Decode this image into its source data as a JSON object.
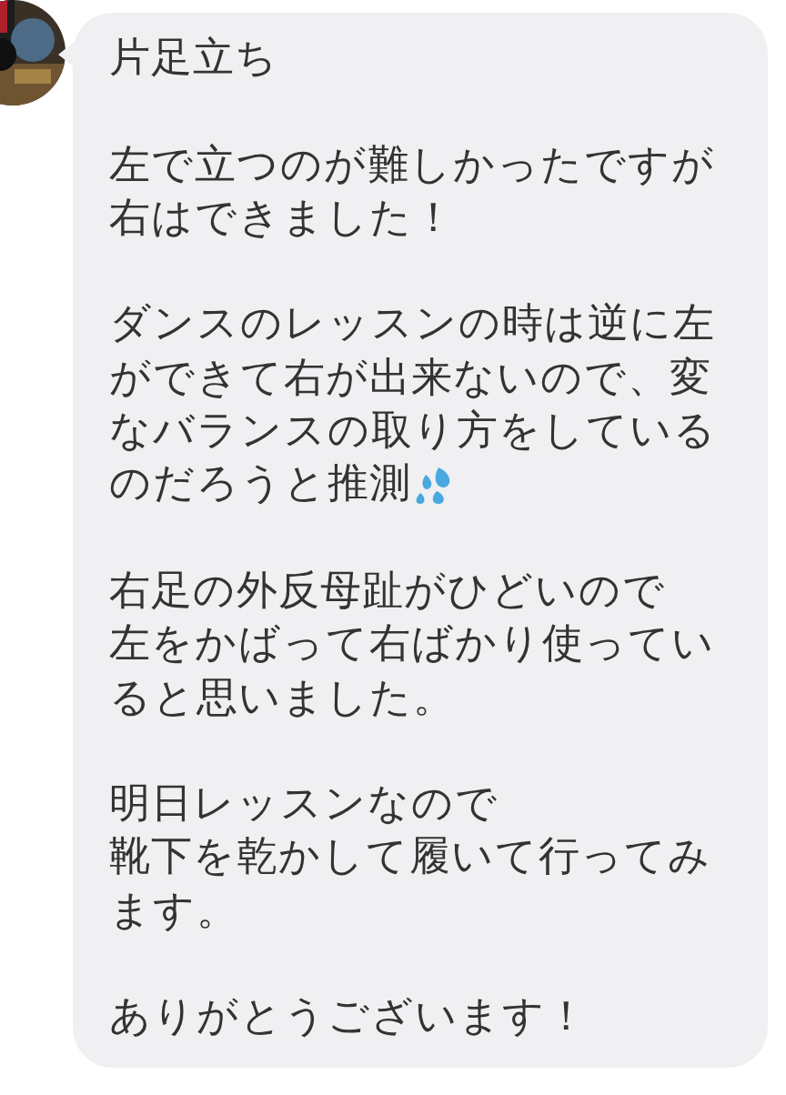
{
  "message": {
    "paragraphs": [
      {
        "lines": [
          {
            "text": "片足立ち"
          }
        ]
      },
      {
        "lines": [
          {
            "text": "左で立つのが難しかったですが右はできました！"
          }
        ]
      },
      {
        "lines": [
          {
            "text": "ダンスのレッスンの時は逆に左ができて右が出来ないので、変なバランスの取り方をしている"
          },
          {
            "text": "のだろうと推測",
            "trailing_emoji": true
          }
        ]
      },
      {
        "lines": [
          {
            "text": "右足の外反母趾がひどいので"
          },
          {
            "text": "左をかばって右ばかり使っていると思いました。"
          }
        ]
      },
      {
        "lines": [
          {
            "text": "明日レッスンなので"
          },
          {
            "text": "靴下を乾かして履いて行ってみます。"
          }
        ]
      },
      {
        "lines": [
          {
            "text": "ありがとうございます！"
          }
        ]
      }
    ]
  }
}
